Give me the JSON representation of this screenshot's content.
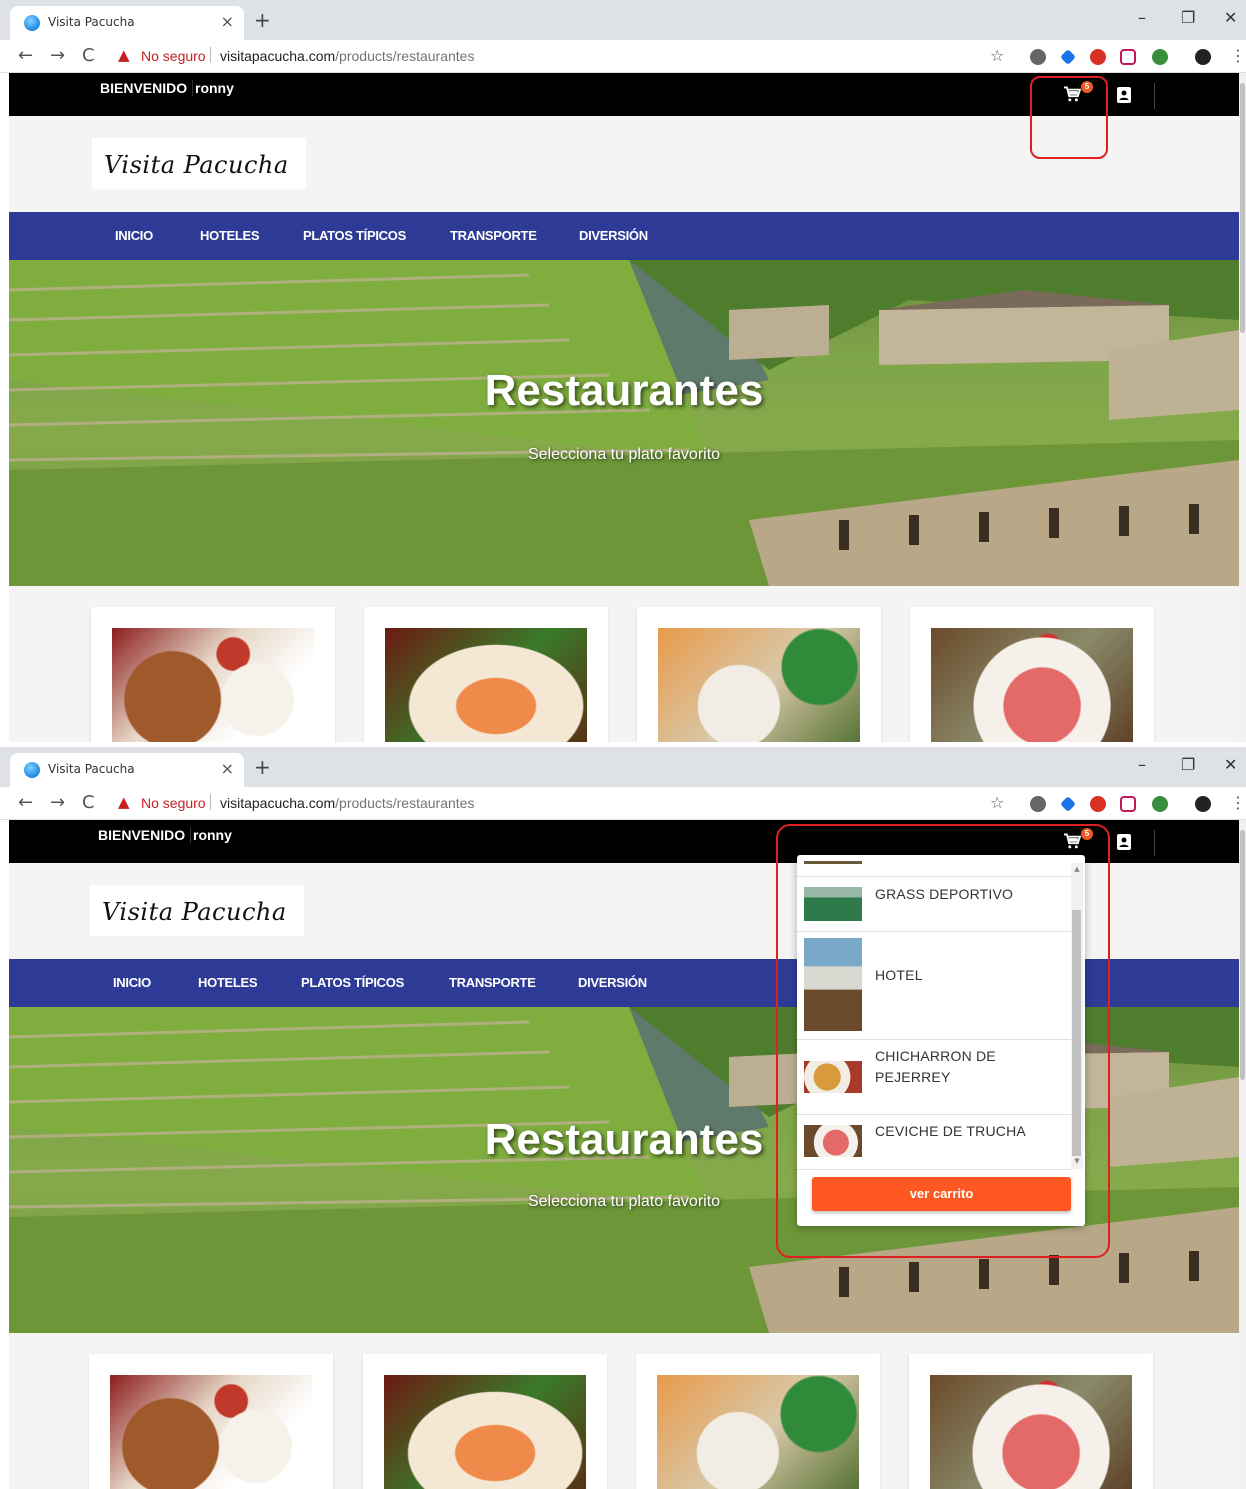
{
  "browser": {
    "tab_title": "Visita Pacucha",
    "tab_close": "×",
    "new_tab": "+",
    "minimize": "–",
    "restore": "❐",
    "close": "✕",
    "back": "←",
    "forward": "→",
    "reload": "C",
    "security_warning_icon": "▲",
    "security_label": "No seguro",
    "url_host": "visitapacucha.com",
    "url_path": "/products/restaurantes",
    "bookmark_star": "☆",
    "menu": "⋮"
  },
  "topbar": {
    "welcome": "BIENVENIDO",
    "username": "ronny",
    "cart_count": "5"
  },
  "logo": {
    "text": "Visita Pacucha"
  },
  "nav": {
    "items": [
      {
        "label": "INICIO"
      },
      {
        "label": "HOTELES"
      },
      {
        "label": "PLATOS TÍPICOS"
      },
      {
        "label": "TRANSPORTE"
      },
      {
        "label": "DIVERSIÓN"
      }
    ]
  },
  "hero": {
    "title": "Restaurantes",
    "subtitle": "Selecciona tu plato favorito"
  },
  "cart_dropdown": {
    "items": [
      {
        "name": "GRASS DEPORTIVO"
      },
      {
        "name": "HOTEL"
      },
      {
        "name": "CHICHARRON DE PEJERREY"
      },
      {
        "name": "CEVICHE DE TRUCHA"
      }
    ],
    "button_label": "ver carrito",
    "scroll_position": 0.85
  },
  "colors": {
    "topbar": "#000000",
    "navbar": "#2e3b96",
    "cart_button": "#ff5722",
    "badge": "#ef5a24",
    "annotation": "#e02020"
  }
}
